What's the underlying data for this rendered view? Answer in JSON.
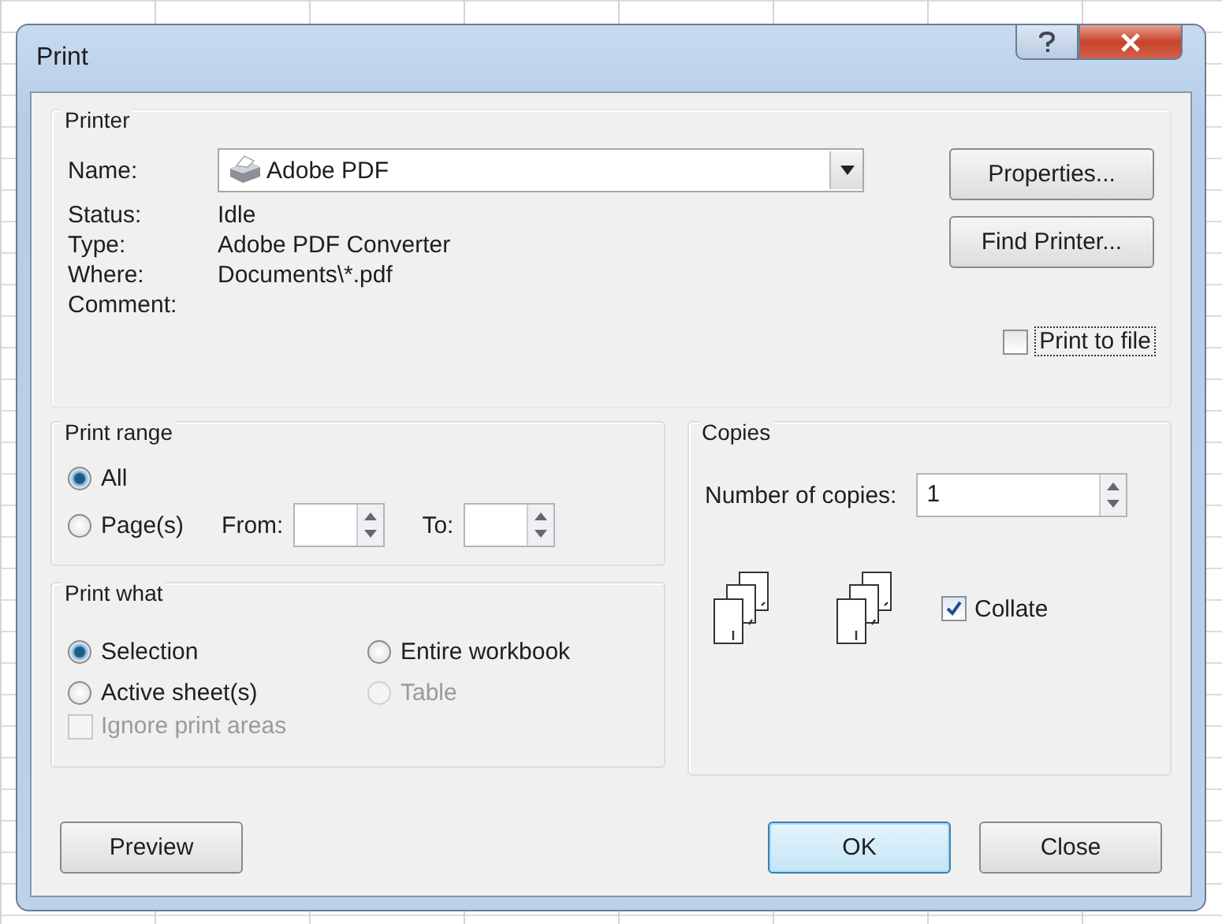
{
  "window": {
    "title": "Print"
  },
  "printer": {
    "heading": "Printer",
    "name_label": "Name:",
    "name_value": "Adobe PDF",
    "details": [
      {
        "label": "Status:",
        "value": "Idle"
      },
      {
        "label": "Type:",
        "value": "Adobe PDF Converter"
      },
      {
        "label": "Where:",
        "value": "Documents\\*.pdf"
      },
      {
        "label": "Comment:"
      }
    ],
    "buttons": [
      "Properties...",
      "Find Printer..."
    ],
    "print_to_file": {
      "label": "Print to file",
      "checked": false
    }
  },
  "print_range": {
    "heading": "Print range",
    "options": [
      {
        "label": "All",
        "selected": true
      },
      {
        "label": "Page(s)",
        "selected": false
      }
    ],
    "from_label": "From:",
    "to_label": "To:"
  },
  "print_what": {
    "heading": "Print what",
    "options": [
      {
        "label": "Selection",
        "selected": true,
        "disabled": false
      },
      {
        "label": "Entire workbook",
        "selected": false,
        "disabled": false
      },
      {
        "label": "Active sheet(s)",
        "selected": false,
        "disabled": false
      },
      {
        "label": "Table",
        "selected": false,
        "disabled": true
      }
    ],
    "ignore_print_areas": {
      "label": "Ignore print areas",
      "checked": false,
      "disabled": true
    }
  },
  "copies": {
    "heading": "Copies",
    "number_label": "Number of copies:",
    "number_value": "1",
    "collate": {
      "label": "Collate",
      "checked": true
    }
  },
  "buttons": [
    {
      "label": "Preview",
      "default": false
    },
    {
      "label": "OK",
      "default": true
    },
    {
      "label": "Close",
      "default": false
    }
  ]
}
